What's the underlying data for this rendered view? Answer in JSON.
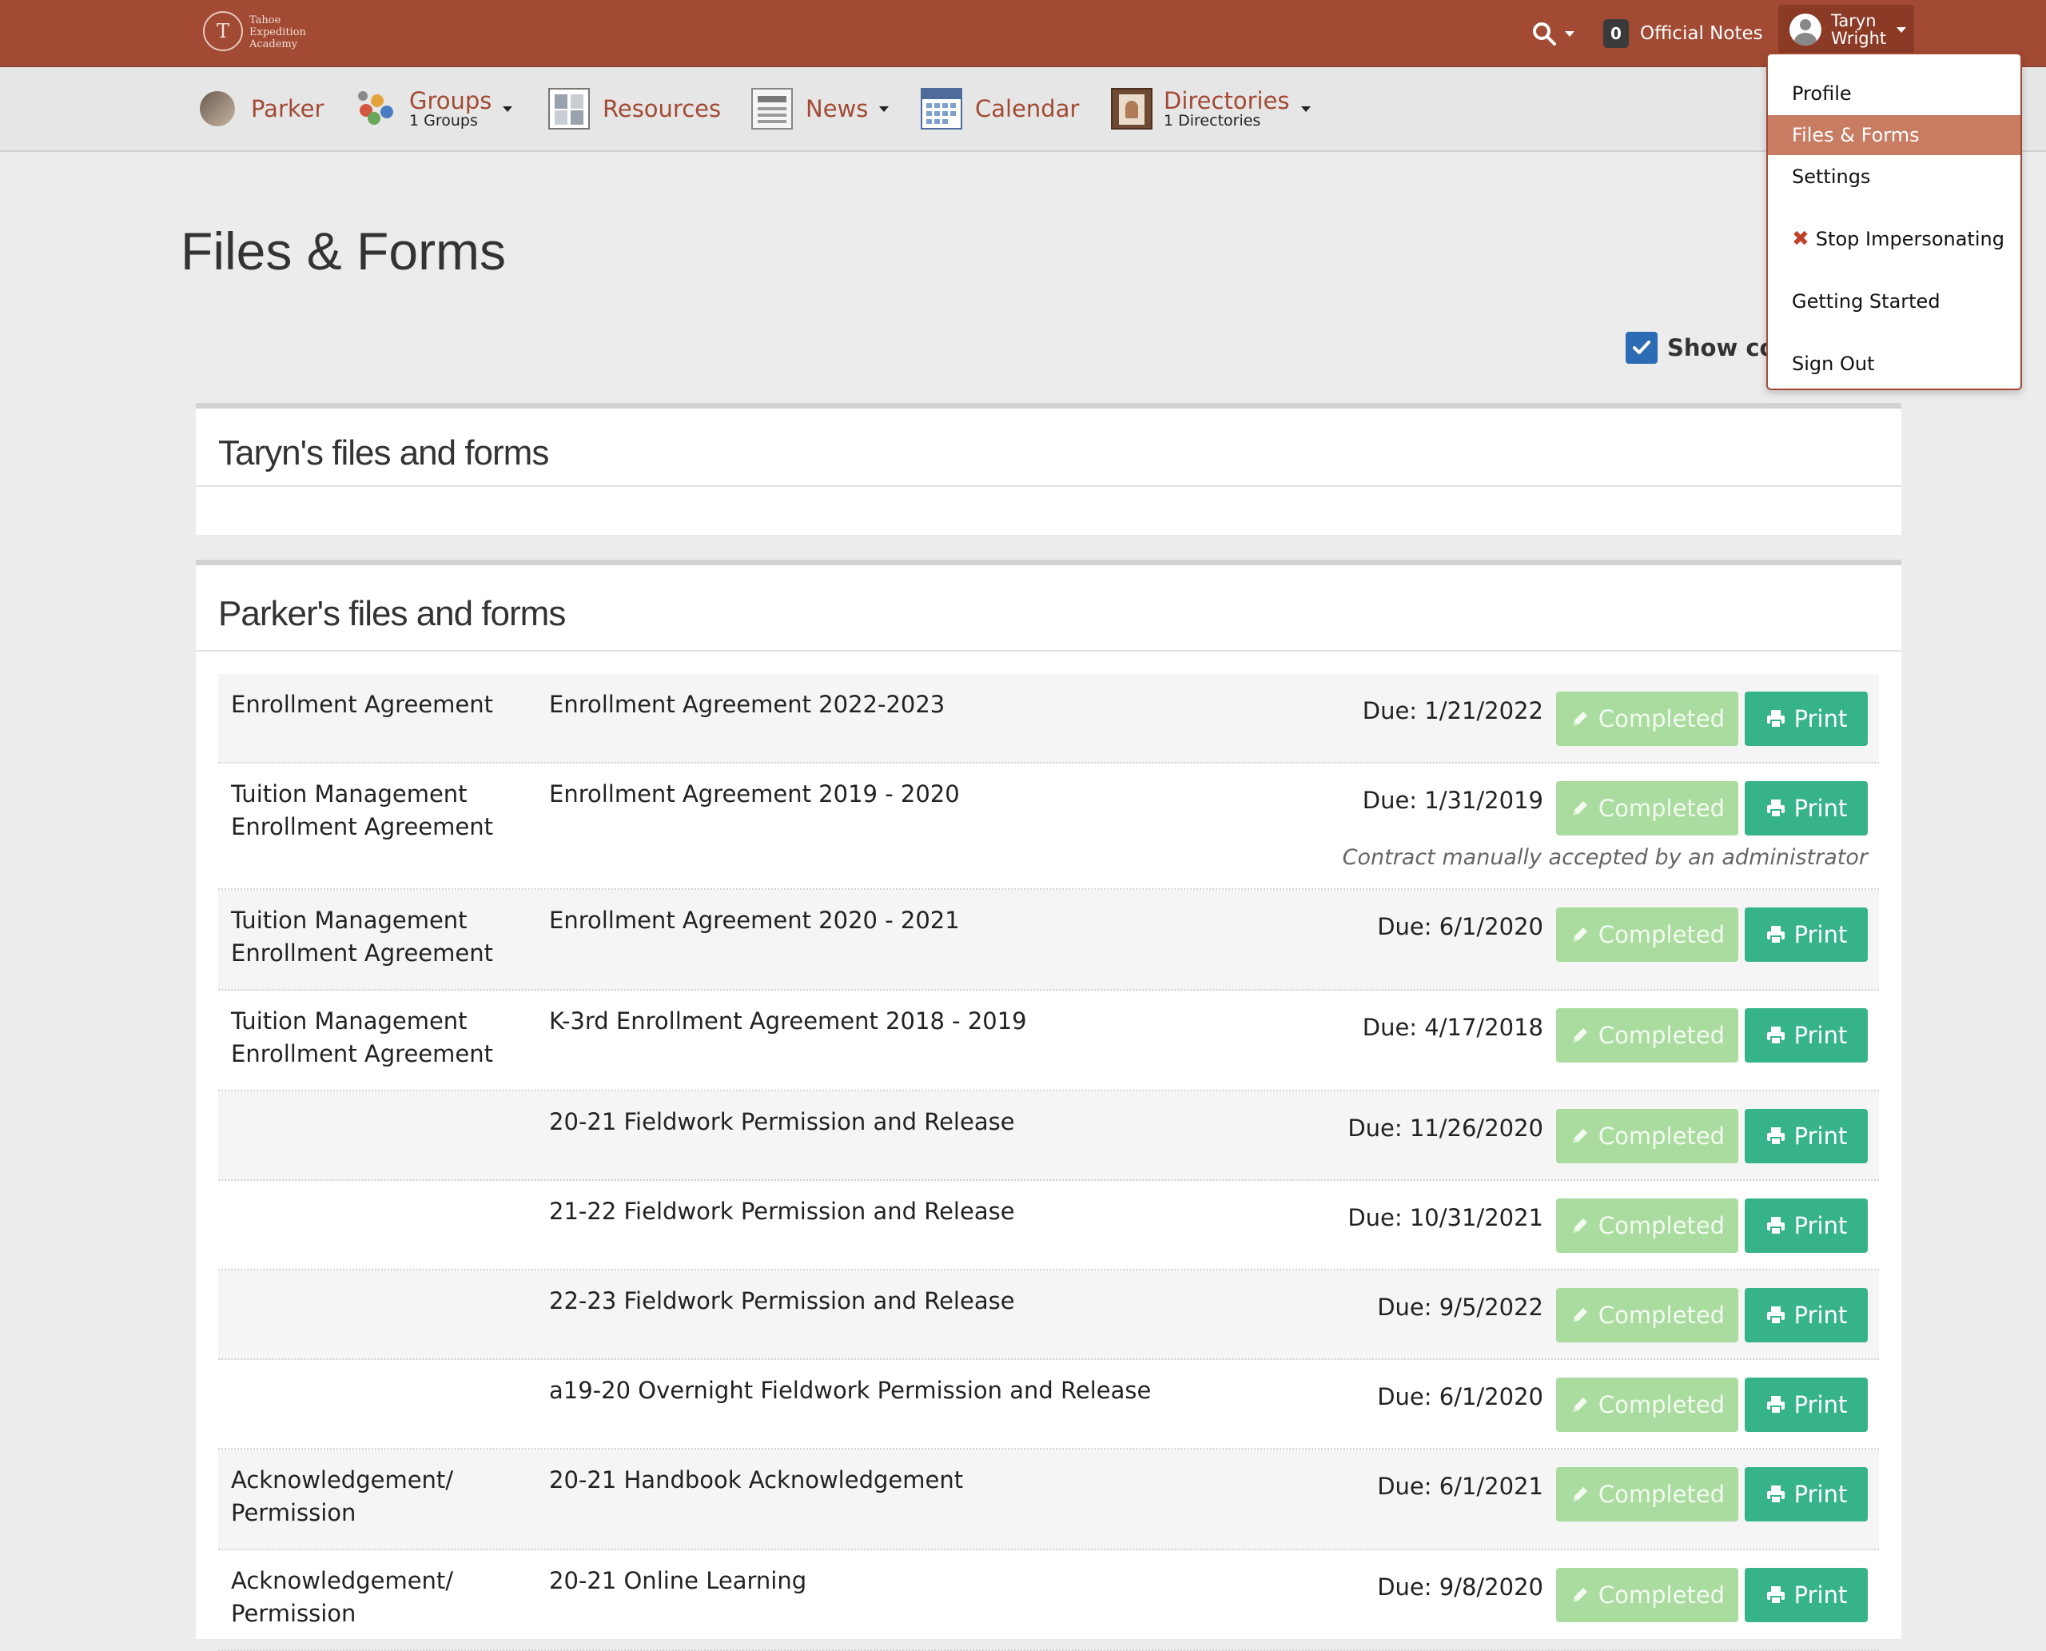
{
  "brand": {
    "logo_letter": "T",
    "logo_text": [
      "Tahoe",
      "Expedition",
      "Academy"
    ]
  },
  "topbar": {
    "notes_count": "0",
    "notes_label": "Official Notes",
    "user_name_line1": "Taryn",
    "user_name_line2": "Wright"
  },
  "nav": {
    "parker": "Parker",
    "groups": "Groups",
    "groups_sub": "1 Groups",
    "resources": "Resources",
    "news": "News",
    "calendar": "Calendar",
    "directories": "Directories",
    "directories_sub": "1 Directories"
  },
  "page": {
    "title": "Files & Forms",
    "show_completed_label": "Show completed",
    "show_completed_checked": true
  },
  "panels": {
    "taryn_title": "Taryn's files and forms",
    "parker_title": "Parker's files and forms"
  },
  "buttons": {
    "completed": "Completed",
    "print": "Print"
  },
  "forms": [
    {
      "category": "Enrollment Agreement",
      "name": "Enrollment Agreement 2022-2023",
      "due": "Due: 1/21/2022",
      "note": ""
    },
    {
      "category": "Tuition Management Enrollment Agreement",
      "name": "Enrollment Agreement 2019 - 2020",
      "due": "Due: 1/31/2019",
      "note": "Contract manually accepted by an administrator"
    },
    {
      "category": "Tuition Management Enrollment Agreement",
      "name": "Enrollment Agreement 2020 - 2021",
      "due": "Due: 6/1/2020",
      "note": ""
    },
    {
      "category": "Tuition Management Enrollment Agreement",
      "name": "K-3rd Enrollment Agreement 2018 - 2019",
      "due": "Due: 4/17/2018",
      "note": ""
    },
    {
      "category": "",
      "name": "20-21 Fieldwork Permission and Release",
      "due": "Due: 11/26/2020",
      "note": ""
    },
    {
      "category": "",
      "name": "21-22 Fieldwork Permission and Release",
      "due": "Due: 10/31/2021",
      "note": ""
    },
    {
      "category": "",
      "name": "22-23 Fieldwork Permission and Release",
      "due": "Due: 9/5/2022",
      "note": ""
    },
    {
      "category": "",
      "name": "a19-20 Overnight Fieldwork Permission and Release",
      "due": "Due: 6/1/2020",
      "note": ""
    },
    {
      "category": "Acknowledgement/ Permission",
      "name": "20-21 Handbook Acknowledgement",
      "due": "Due: 6/1/2021",
      "note": ""
    },
    {
      "category": "Acknowledgement/ Permission",
      "name": "20-21 Online Learning",
      "due": "Due: 9/8/2020",
      "note": ""
    }
  ],
  "user_menu": {
    "items": [
      {
        "label": "Profile",
        "active": false
      },
      {
        "label": "Files & Forms",
        "active": true
      },
      {
        "label": "Settings",
        "active": false
      },
      {
        "label": "Stop Impersonating",
        "active": false,
        "icon": "x-icon"
      },
      {
        "label": "Getting Started",
        "active": false
      },
      {
        "label": "Sign Out",
        "active": false
      }
    ]
  },
  "colors": {
    "brand": "#a24a33",
    "completed_button": "#a9dc9e",
    "print_button": "#37b38a",
    "checkbox": "#2b6cb5",
    "menu_active": "#c87c62"
  }
}
